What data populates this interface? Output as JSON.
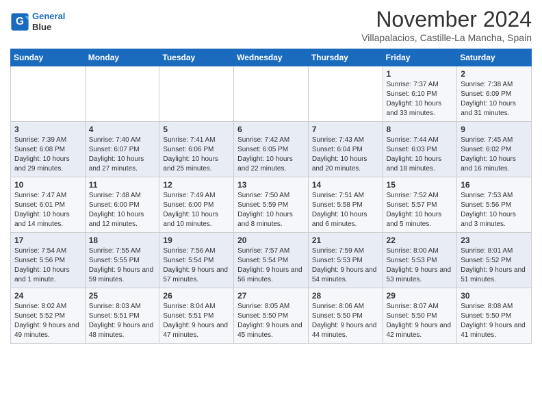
{
  "header": {
    "logo_line1": "General",
    "logo_line2": "Blue",
    "month": "November 2024",
    "location": "Villapalacios, Castille-La Mancha, Spain"
  },
  "weekdays": [
    "Sunday",
    "Monday",
    "Tuesday",
    "Wednesday",
    "Thursday",
    "Friday",
    "Saturday"
  ],
  "weeks": [
    [
      {
        "day": "",
        "info": ""
      },
      {
        "day": "",
        "info": ""
      },
      {
        "day": "",
        "info": ""
      },
      {
        "day": "",
        "info": ""
      },
      {
        "day": "",
        "info": ""
      },
      {
        "day": "1",
        "info": "Sunrise: 7:37 AM\nSunset: 6:10 PM\nDaylight: 10 hours and 33 minutes."
      },
      {
        "day": "2",
        "info": "Sunrise: 7:38 AM\nSunset: 6:09 PM\nDaylight: 10 hours and 31 minutes."
      }
    ],
    [
      {
        "day": "3",
        "info": "Sunrise: 7:39 AM\nSunset: 6:08 PM\nDaylight: 10 hours and 29 minutes."
      },
      {
        "day": "4",
        "info": "Sunrise: 7:40 AM\nSunset: 6:07 PM\nDaylight: 10 hours and 27 minutes."
      },
      {
        "day": "5",
        "info": "Sunrise: 7:41 AM\nSunset: 6:06 PM\nDaylight: 10 hours and 25 minutes."
      },
      {
        "day": "6",
        "info": "Sunrise: 7:42 AM\nSunset: 6:05 PM\nDaylight: 10 hours and 22 minutes."
      },
      {
        "day": "7",
        "info": "Sunrise: 7:43 AM\nSunset: 6:04 PM\nDaylight: 10 hours and 20 minutes."
      },
      {
        "day": "8",
        "info": "Sunrise: 7:44 AM\nSunset: 6:03 PM\nDaylight: 10 hours and 18 minutes."
      },
      {
        "day": "9",
        "info": "Sunrise: 7:45 AM\nSunset: 6:02 PM\nDaylight: 10 hours and 16 minutes."
      }
    ],
    [
      {
        "day": "10",
        "info": "Sunrise: 7:47 AM\nSunset: 6:01 PM\nDaylight: 10 hours and 14 minutes."
      },
      {
        "day": "11",
        "info": "Sunrise: 7:48 AM\nSunset: 6:00 PM\nDaylight: 10 hours and 12 minutes."
      },
      {
        "day": "12",
        "info": "Sunrise: 7:49 AM\nSunset: 6:00 PM\nDaylight: 10 hours and 10 minutes."
      },
      {
        "day": "13",
        "info": "Sunrise: 7:50 AM\nSunset: 5:59 PM\nDaylight: 10 hours and 8 minutes."
      },
      {
        "day": "14",
        "info": "Sunrise: 7:51 AM\nSunset: 5:58 PM\nDaylight: 10 hours and 6 minutes."
      },
      {
        "day": "15",
        "info": "Sunrise: 7:52 AM\nSunset: 5:57 PM\nDaylight: 10 hours and 5 minutes."
      },
      {
        "day": "16",
        "info": "Sunrise: 7:53 AM\nSunset: 5:56 PM\nDaylight: 10 hours and 3 minutes."
      }
    ],
    [
      {
        "day": "17",
        "info": "Sunrise: 7:54 AM\nSunset: 5:56 PM\nDaylight: 10 hours and 1 minute."
      },
      {
        "day": "18",
        "info": "Sunrise: 7:55 AM\nSunset: 5:55 PM\nDaylight: 9 hours and 59 minutes."
      },
      {
        "day": "19",
        "info": "Sunrise: 7:56 AM\nSunset: 5:54 PM\nDaylight: 9 hours and 57 minutes."
      },
      {
        "day": "20",
        "info": "Sunrise: 7:57 AM\nSunset: 5:54 PM\nDaylight: 9 hours and 56 minutes."
      },
      {
        "day": "21",
        "info": "Sunrise: 7:59 AM\nSunset: 5:53 PM\nDaylight: 9 hours and 54 minutes."
      },
      {
        "day": "22",
        "info": "Sunrise: 8:00 AM\nSunset: 5:53 PM\nDaylight: 9 hours and 53 minutes."
      },
      {
        "day": "23",
        "info": "Sunrise: 8:01 AM\nSunset: 5:52 PM\nDaylight: 9 hours and 51 minutes."
      }
    ],
    [
      {
        "day": "24",
        "info": "Sunrise: 8:02 AM\nSunset: 5:52 PM\nDaylight: 9 hours and 49 minutes."
      },
      {
        "day": "25",
        "info": "Sunrise: 8:03 AM\nSunset: 5:51 PM\nDaylight: 9 hours and 48 minutes."
      },
      {
        "day": "26",
        "info": "Sunrise: 8:04 AM\nSunset: 5:51 PM\nDaylight: 9 hours and 47 minutes."
      },
      {
        "day": "27",
        "info": "Sunrise: 8:05 AM\nSunset: 5:50 PM\nDaylight: 9 hours and 45 minutes."
      },
      {
        "day": "28",
        "info": "Sunrise: 8:06 AM\nSunset: 5:50 PM\nDaylight: 9 hours and 44 minutes."
      },
      {
        "day": "29",
        "info": "Sunrise: 8:07 AM\nSunset: 5:50 PM\nDaylight: 9 hours and 42 minutes."
      },
      {
        "day": "30",
        "info": "Sunrise: 8:08 AM\nSunset: 5:50 PM\nDaylight: 9 hours and 41 minutes."
      }
    ]
  ]
}
